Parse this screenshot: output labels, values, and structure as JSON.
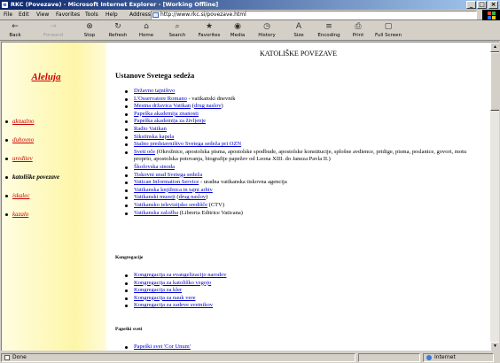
{
  "window": {
    "title": "RKC (Povezave) - Microsoft Internet Explorer - [Working Offline]",
    "controls": [
      "_",
      "□",
      "×"
    ]
  },
  "menu": [
    "File",
    "Edit",
    "View",
    "Favorites",
    "Tools",
    "Help"
  ],
  "address": {
    "label": "Address",
    "url": "http://www.rkc.si/povezave.html"
  },
  "toolbar": [
    {
      "label": "Back",
      "icon": "back-arrow-icon",
      "glyph": "←"
    },
    {
      "label": "Forward",
      "icon": "forward-arrow-icon",
      "glyph": "→"
    },
    {
      "label": "Stop",
      "icon": "stop-icon",
      "glyph": "⊗"
    },
    {
      "label": "Refresh",
      "icon": "refresh-icon",
      "glyph": "↻"
    },
    {
      "label": "Home",
      "icon": "home-icon",
      "glyph": "⌂"
    },
    {
      "label": "Search",
      "icon": "search-icon",
      "glyph": "⌕"
    },
    {
      "label": "Favorites",
      "icon": "favorites-icon",
      "glyph": "★"
    },
    {
      "label": "Media",
      "icon": "media-icon",
      "glyph": "◉"
    },
    {
      "label": "History",
      "icon": "history-icon",
      "glyph": "◷"
    },
    {
      "label": "Size",
      "icon": "text-size-icon",
      "glyph": "A"
    },
    {
      "label": "Encoding",
      "icon": "encoding-icon",
      "glyph": "≡"
    },
    {
      "label": "Print",
      "icon": "print-icon",
      "glyph": "⎙"
    },
    {
      "label": "Full Screen",
      "icon": "full-screen-icon",
      "glyph": "▢"
    }
  ],
  "sidebar": {
    "title": "Aleluja",
    "items": [
      {
        "label": "aktualno",
        "current": false
      },
      {
        "label": "duhovno",
        "current": false
      },
      {
        "label": "ureditev",
        "current": false
      },
      {
        "label": "katoliške povezave",
        "current": true
      },
      {
        "label": "iskalec",
        "current": false
      },
      {
        "label": "kazalo",
        "current": false
      }
    ]
  },
  "page": {
    "title": "KATOLIŠKE POVEZAVE",
    "section_main": "Ustanove Svetega sedeža",
    "section_kongregacije": "Kongregacije",
    "section_papeski_sveti": "Papeški sveti"
  },
  "links_ustanove": [
    {
      "parts": [
        {
          "t": "Državno tajništvo",
          "link": true
        }
      ]
    },
    {
      "parts": [
        {
          "t": "L'Osservatore Romano",
          "link": true
        },
        {
          "t": " - vatikanski dnevnik",
          "link": false
        }
      ]
    },
    {
      "parts": [
        {
          "t": "Mestna državica Vatikan",
          "link": true
        },
        {
          "t": " (",
          "link": false
        },
        {
          "t": "drug naslov",
          "link": true
        },
        {
          "t": ")",
          "link": false
        }
      ]
    },
    {
      "parts": [
        {
          "t": "Papeška akademija znanosti",
          "link": true
        }
      ]
    },
    {
      "parts": [
        {
          "t": "Papeška akademija za življenje",
          "link": true
        }
      ]
    },
    {
      "parts": [
        {
          "t": "Radio Vatikan",
          "link": true
        }
      ]
    },
    {
      "parts": [
        {
          "t": "Sikstinska kapela",
          "link": true
        }
      ]
    },
    {
      "parts": [
        {
          "t": "Stalno predstavništvo Svetega sedeža pri OZN",
          "link": true
        }
      ]
    },
    {
      "parts": [
        {
          "t": "Sveti oče",
          "link": true
        },
        {
          "t": " (Okrožnice, apostolska pisma, apostolske spodbude, apostolske konstitucije, splošne avdience, pridige, pisma, poslanice, govori, motu proprio, apostolska potovanja, biografije papežev od Leona XIII. do Janeza Pavla II.)",
          "link": false
        }
      ]
    },
    {
      "parts": [
        {
          "t": "Škofovska sinoda",
          "link": true
        }
      ]
    },
    {
      "parts": [
        {
          "t": "Tiskovni urad Svetega sedeža",
          "link": true
        }
      ]
    },
    {
      "parts": [
        {
          "t": "Vatican Information Service",
          "link": true
        },
        {
          "t": " - uradna vatikanska tiskovna agencija",
          "link": false
        }
      ]
    },
    {
      "parts": [
        {
          "t": "Vatikanska knjižnica in tajni arhiv",
          "link": true
        }
      ]
    },
    {
      "parts": [
        {
          "t": "Vatikanski muzeji",
          "link": true
        },
        {
          "t": " (",
          "link": false
        },
        {
          "t": "drug naslov",
          "link": true
        },
        {
          "t": ")",
          "link": false
        }
      ]
    },
    {
      "parts": [
        {
          "t": "Vatikansko televizijsko središče",
          "link": true
        },
        {
          "t": " (CTV)",
          "link": false
        }
      ]
    },
    {
      "parts": [
        {
          "t": "Vatikanska založba",
          "link": true
        },
        {
          "t": " (Libreria Editrice Vaticana)",
          "link": false
        }
      ]
    }
  ],
  "links_kongregacije": [
    {
      "parts": [
        {
          "t": "Kongregacija za evangelizacijo narodov",
          "link": true
        }
      ]
    },
    {
      "parts": [
        {
          "t": "Kongregacija za katoliško vzgojo",
          "link": true
        }
      ]
    },
    {
      "parts": [
        {
          "t": "Kongregacija za kler",
          "link": true
        }
      ]
    },
    {
      "parts": [
        {
          "t": "Kongregacija za nauk vere",
          "link": true
        }
      ]
    },
    {
      "parts": [
        {
          "t": "Kongregacija za zadeve svetnikov",
          "link": true
        }
      ]
    }
  ],
  "links_sveti": [
    {
      "parts": [
        {
          "t": "Papeški svet 'Cor Unum'",
          "link": true
        }
      ]
    }
  ],
  "status": {
    "text": "Done",
    "zone": "Internet"
  }
}
